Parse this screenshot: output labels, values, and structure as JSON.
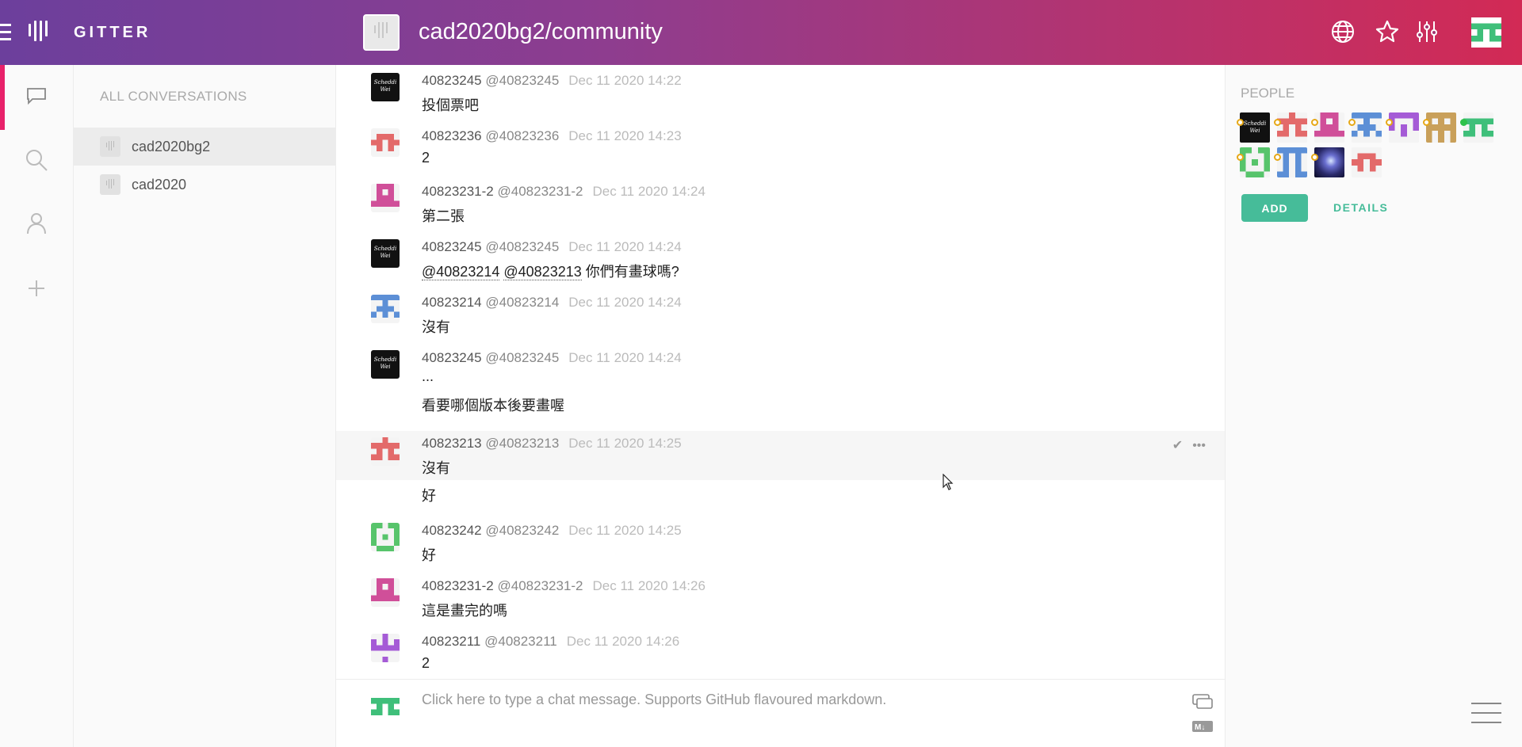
{
  "header": {
    "logo_text": "GITTER",
    "room_title": "cad2020bg2/community",
    "icons": [
      "globe-icon",
      "star-icon",
      "settings-sliders-icon"
    ]
  },
  "rail": {
    "icons": [
      "chat-bubble-icon",
      "search-icon",
      "person-icon",
      "plus-icon"
    ]
  },
  "conversations": {
    "title": "ALL CONVERSATIONS",
    "items": [
      {
        "name": "cad2020bg2",
        "active": true
      },
      {
        "name": "cad2020",
        "active": false
      }
    ]
  },
  "messages": [
    {
      "display": "40823245",
      "handle": "@40823245",
      "time": "Dec 11 2020 14:22",
      "lines": [
        "投個票吧"
      ],
      "avatar": "scheddi"
    },
    {
      "display": "40823236",
      "handle": "@40823236",
      "time": "Dec 11 2020 14:23",
      "lines": [
        "2"
      ],
      "avatar": "red-a"
    },
    {
      "display": "40823231-2",
      "handle": "@40823231-2",
      "time": "Dec 11 2020 14:24",
      "lines": [
        "第二張"
      ],
      "avatar": "pink"
    },
    {
      "display": "40823245",
      "handle": "@40823245",
      "time": "Dec 11 2020 14:24",
      "mentions": [
        "@40823214",
        "@40823213"
      ],
      "mention_tail": "你們有畫球嗎?",
      "lines": [],
      "avatar": "scheddi"
    },
    {
      "display": "40823214",
      "handle": "@40823214",
      "time": "Dec 11 2020 14:24",
      "lines": [
        "沒有"
      ],
      "avatar": "blue"
    },
    {
      "display": "40823245",
      "handle": "@40823245",
      "time": "Dec 11 2020 14:24",
      "lines": [
        "...",
        "看要哪個版本後要畫喔"
      ],
      "avatar": "scheddi"
    },
    {
      "display": "40823213",
      "handle": "@40823213",
      "time": "Dec 11 2020 14:25",
      "lines": [
        "沒有",
        "好"
      ],
      "avatar": "red-b"
    },
    {
      "display": "40823242",
      "handle": "@40823242",
      "time": "Dec 11 2020 14:25",
      "lines": [
        "好"
      ],
      "avatar": "green"
    },
    {
      "display": "40823231-2",
      "handle": "@40823231-2",
      "time": "Dec 11 2020 14:26",
      "lines": [
        "這是畫完的嗎"
      ],
      "avatar": "pink"
    },
    {
      "display": "40823211",
      "handle": "@40823211",
      "time": "Dec 11 2020 14:26",
      "lines": [
        "2"
      ],
      "avatar": "purple"
    }
  ],
  "composer": {
    "placeholder": "Click here to type a chat message. Supports GitHub flavoured markdown."
  },
  "avatar_text": "Scheddi Wei",
  "people": {
    "title": "PEOPLE",
    "add_label": "ADD",
    "details_label": "DETAILS",
    "count": 11
  },
  "colors": {
    "accent_green": "#46bc99",
    "active_rail": "#e8216a",
    "header_start": "#6c3f9c",
    "header_end": "#d22a55"
  }
}
